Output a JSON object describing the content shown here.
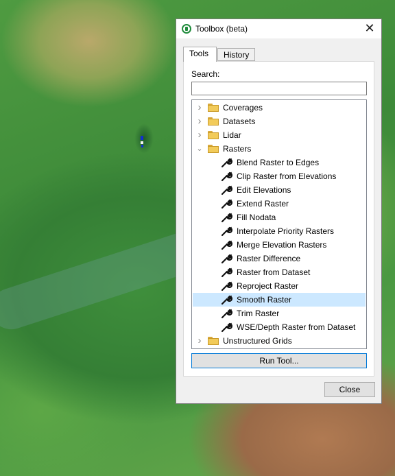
{
  "window": {
    "title": "Toolbox (beta)",
    "close_glyph": "✕"
  },
  "tabs": [
    {
      "label": "Tools",
      "active": true
    },
    {
      "label": "History",
      "active": false
    }
  ],
  "search": {
    "label": "Search:",
    "value": "",
    "placeholder": ""
  },
  "tree": [
    {
      "type": "folder",
      "label": "Coverages",
      "expanded": false
    },
    {
      "type": "folder",
      "label": "Datasets",
      "expanded": false
    },
    {
      "type": "folder",
      "label": "Lidar",
      "expanded": false
    },
    {
      "type": "folder",
      "label": "Rasters",
      "expanded": true
    },
    {
      "type": "tool",
      "label": "Blend Raster to Edges"
    },
    {
      "type": "tool",
      "label": "Clip Raster from Elevations"
    },
    {
      "type": "tool",
      "label": "Edit Elevations"
    },
    {
      "type": "tool",
      "label": "Extend Raster"
    },
    {
      "type": "tool",
      "label": "Fill Nodata"
    },
    {
      "type": "tool",
      "label": "Interpolate Priority Rasters"
    },
    {
      "type": "tool",
      "label": "Merge Elevation Rasters"
    },
    {
      "type": "tool",
      "label": "Raster Difference"
    },
    {
      "type": "tool",
      "label": "Raster from Dataset"
    },
    {
      "type": "tool",
      "label": "Reproject Raster"
    },
    {
      "type": "tool",
      "label": "Smooth Raster",
      "selected": true
    },
    {
      "type": "tool",
      "label": "Trim Raster"
    },
    {
      "type": "tool",
      "label": "WSE/Depth Raster from Dataset"
    },
    {
      "type": "folder",
      "label": "Unstructured Grids",
      "expanded": false
    }
  ],
  "buttons": {
    "run": "Run Tool...",
    "close": "Close"
  },
  "icons": {
    "app": "toolbox-app-icon",
    "folder": "folder-icon",
    "tool": "wrench-icon",
    "expand": "chevron-right-icon",
    "collapse": "chevron-down-icon"
  },
  "colors": {
    "selection": "#cce8ff",
    "accent_border": "#0078d7",
    "folder": "#f2cb5a"
  }
}
